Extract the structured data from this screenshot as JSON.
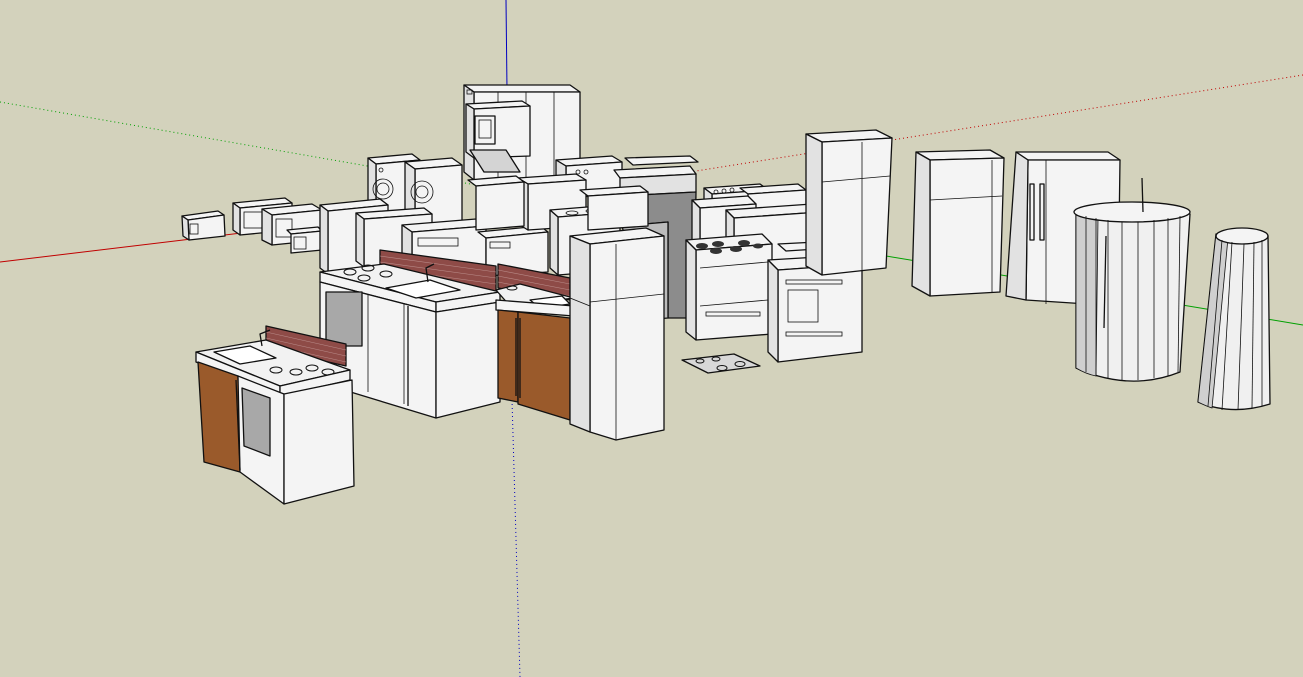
{
  "app": {
    "type": "3d-modeling-viewport",
    "background": "#d3d2bc"
  },
  "axes": {
    "red": "#c00000",
    "green": "#00a000",
    "blue": "#0000c0"
  },
  "materials": {
    "white": "#f4f4f4",
    "side": "#e2e2e2",
    "dark_side": "#cfcfcf",
    "wood": "#9a5a2b",
    "brick": "#8e4b47",
    "glass": "#a8a8a8"
  },
  "models": [
    "microwave",
    "microwave",
    "microwave",
    "washer",
    "dryer",
    "stacked-washer-dryer",
    "refrigerator",
    "refrigerator",
    "side-by-side-refrigerator",
    "cylindrical-refrigerator",
    "cylindrical-refrigerator",
    "range-stove",
    "range-stove",
    "range-hood",
    "kitchen-sink-counter",
    "kitchen-sink-counter",
    "kitchen-unit-compact",
    "cooktop"
  ]
}
